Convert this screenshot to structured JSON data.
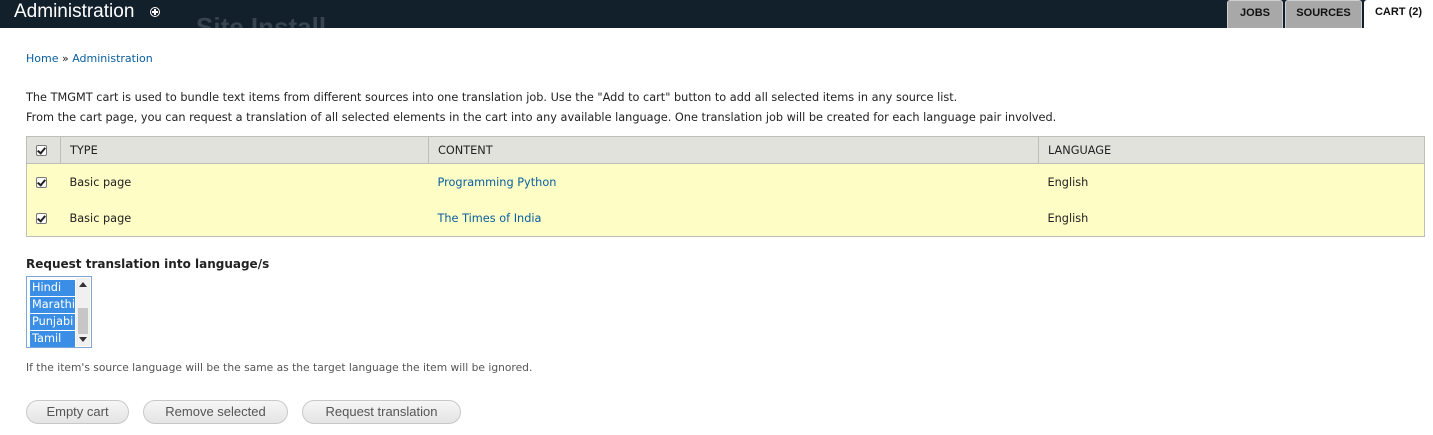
{
  "header": {
    "title": "Administration",
    "ghost_text": "Site Install",
    "tabs": [
      {
        "label": "JOBS"
      },
      {
        "label": "SOURCES"
      },
      {
        "label": "CART (2)"
      }
    ]
  },
  "breadcrumb": {
    "home": "Home",
    "separator": "»",
    "current": "Administration"
  },
  "intro": {
    "line1": "The TMGMT cart is used to bundle text items from different sources into one translation job. Use the \"Add to cart\" button to add all selected items in any source list.",
    "line2": "From the cart page, you can request a translation of all selected elements in the cart into any available language. One translation job will be created for each language pair involved."
  },
  "table": {
    "columns": [
      "TYPE",
      "CONTENT",
      "LANGUAGE"
    ],
    "rows": [
      {
        "checked": true,
        "type": "Basic page",
        "content": "Programming Python",
        "language": "English"
      },
      {
        "checked": true,
        "type": "Basic page",
        "content": "The Times of India",
        "language": "English"
      }
    ]
  },
  "request": {
    "label": "Request translation into language/s",
    "options": [
      "Hindi",
      "Marathi",
      "Punjabi",
      "Tamil"
    ],
    "help": "If the item's source language will be the same as the target language the item will be ignored."
  },
  "buttons": {
    "empty_cart": "Empty cart",
    "remove_selected": "Remove selected",
    "request_translation": "Request translation"
  },
  "colors": {
    "topbar": "#12202c",
    "row_highlight": "#fefdc6",
    "header_bg": "#e1e2dc",
    "link": "#0a5fa0",
    "selected_option": "#3a8ee6"
  }
}
